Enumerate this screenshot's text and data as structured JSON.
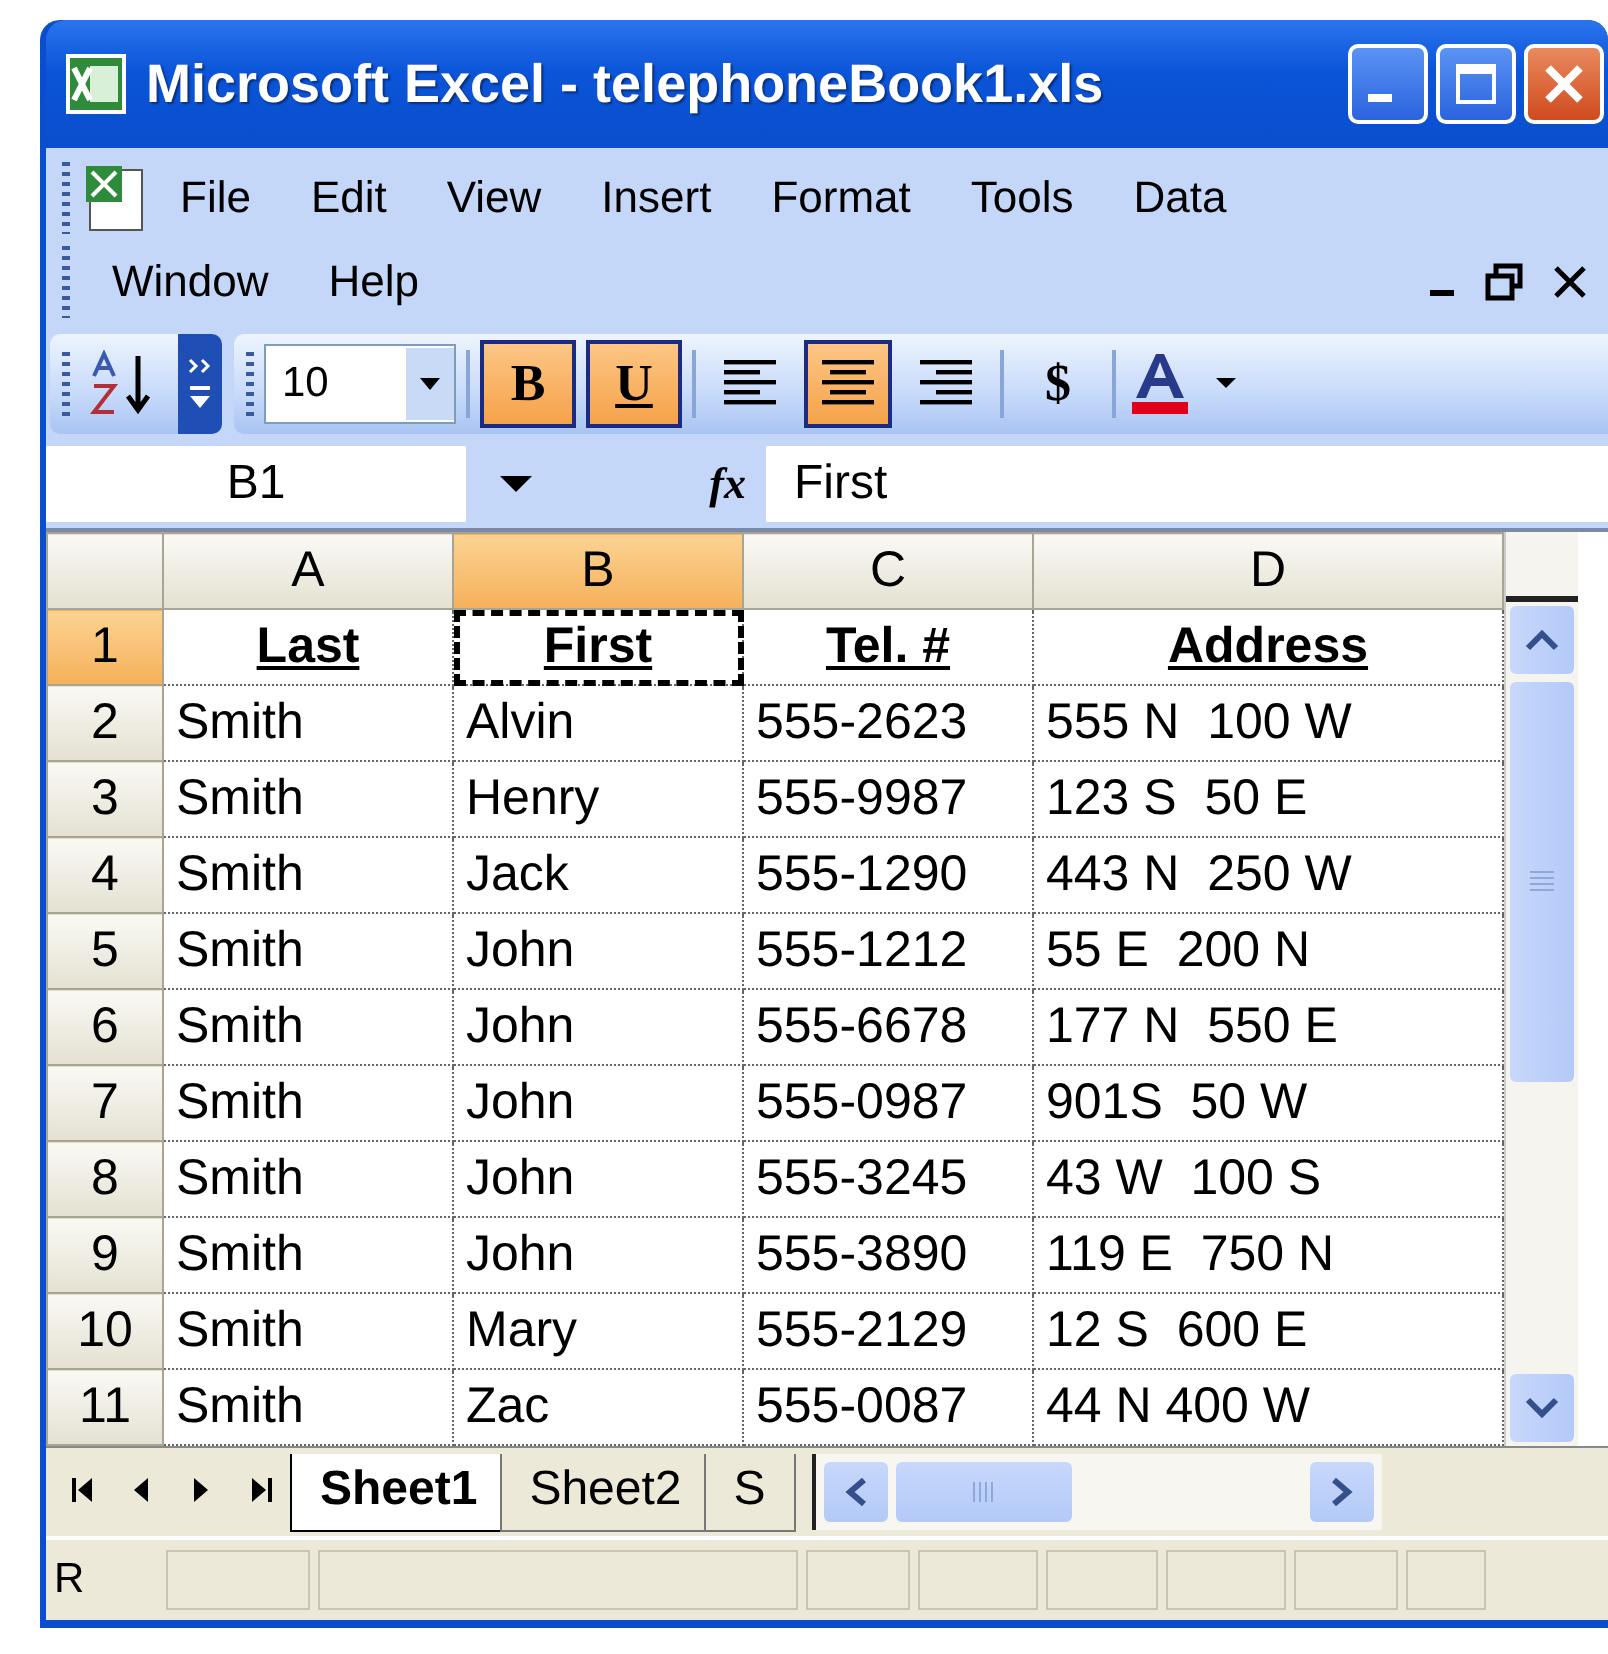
{
  "window": {
    "title": "Microsoft Excel - telephoneBook1.xls"
  },
  "menu_rows": [
    [
      "File",
      "Edit",
      "View",
      "Insert",
      "Format",
      "Tools",
      "Data"
    ],
    [
      "Window",
      "Help"
    ]
  ],
  "toolbar": {
    "font_size": "10",
    "buttons": [
      {
        "kind": "bold",
        "label": "B",
        "selected": true
      },
      {
        "kind": "underline",
        "label": "U",
        "selected": true
      },
      {
        "kind": "align-left",
        "selected": false
      },
      {
        "kind": "align-center",
        "selected": true
      },
      {
        "kind": "align-right",
        "selected": false
      },
      {
        "kind": "currency",
        "label": "$",
        "selected": false
      },
      {
        "kind": "font-color",
        "selected": false
      }
    ]
  },
  "formula_bar": {
    "name_box": "B1",
    "function_label": "fx",
    "value": "First"
  },
  "sheet": {
    "columns": [
      {
        "label": "A",
        "selected": false
      },
      {
        "label": "B",
        "selected": true
      },
      {
        "label": "C",
        "selected": false
      },
      {
        "label": "D",
        "selected": false
      }
    ],
    "rows": [
      {
        "number": "1",
        "selected": true,
        "kind": "heading",
        "cells": [
          "Last",
          "First",
          "Tel. #",
          "Address"
        ]
      },
      {
        "number": "2",
        "selected": false,
        "kind": "data",
        "cells": [
          "Smith",
          "Alvin",
          "555-2623",
          "555 N  100 W"
        ]
      },
      {
        "number": "3",
        "selected": false,
        "kind": "data",
        "cells": [
          "Smith",
          "Henry",
          "555-9987",
          "123 S  50 E"
        ]
      },
      {
        "number": "4",
        "selected": false,
        "kind": "data",
        "cells": [
          "Smith",
          "Jack",
          "555-1290",
          "443 N  250 W"
        ]
      },
      {
        "number": "5",
        "selected": false,
        "kind": "data",
        "cells": [
          "Smith",
          "John",
          "555-1212",
          "55 E  200 N"
        ]
      },
      {
        "number": "6",
        "selected": false,
        "kind": "data",
        "cells": [
          "Smith",
          "John",
          "555-6678",
          "177 N  550 E"
        ]
      },
      {
        "number": "7",
        "selected": false,
        "kind": "data",
        "cells": [
          "Smith",
          "John",
          "555-0987",
          "901S  50 W"
        ]
      },
      {
        "number": "8",
        "selected": false,
        "kind": "data",
        "cells": [
          "Smith",
          "John",
          "555-3245",
          "43 W  100 S"
        ]
      },
      {
        "number": "9",
        "selected": false,
        "kind": "data",
        "cells": [
          "Smith",
          "John",
          "555-3890",
          "119 E  750 N"
        ]
      },
      {
        "number": "10",
        "selected": false,
        "kind": "data",
        "cells": [
          "Smith",
          "Mary",
          "555-2129",
          "12 S  600 E"
        ]
      },
      {
        "number": "11",
        "selected": false,
        "kind": "data",
        "cells": [
          "Smith",
          "Zac",
          "555-0087",
          "44 N 400 W"
        ]
      }
    ]
  },
  "sheet_tabs": [
    {
      "label": "Sheet1",
      "selected": true
    },
    {
      "label": "Sheet2",
      "selected": false
    },
    {
      "label": "S",
      "selected": false
    }
  ],
  "status_bar": {
    "text": "R"
  }
}
